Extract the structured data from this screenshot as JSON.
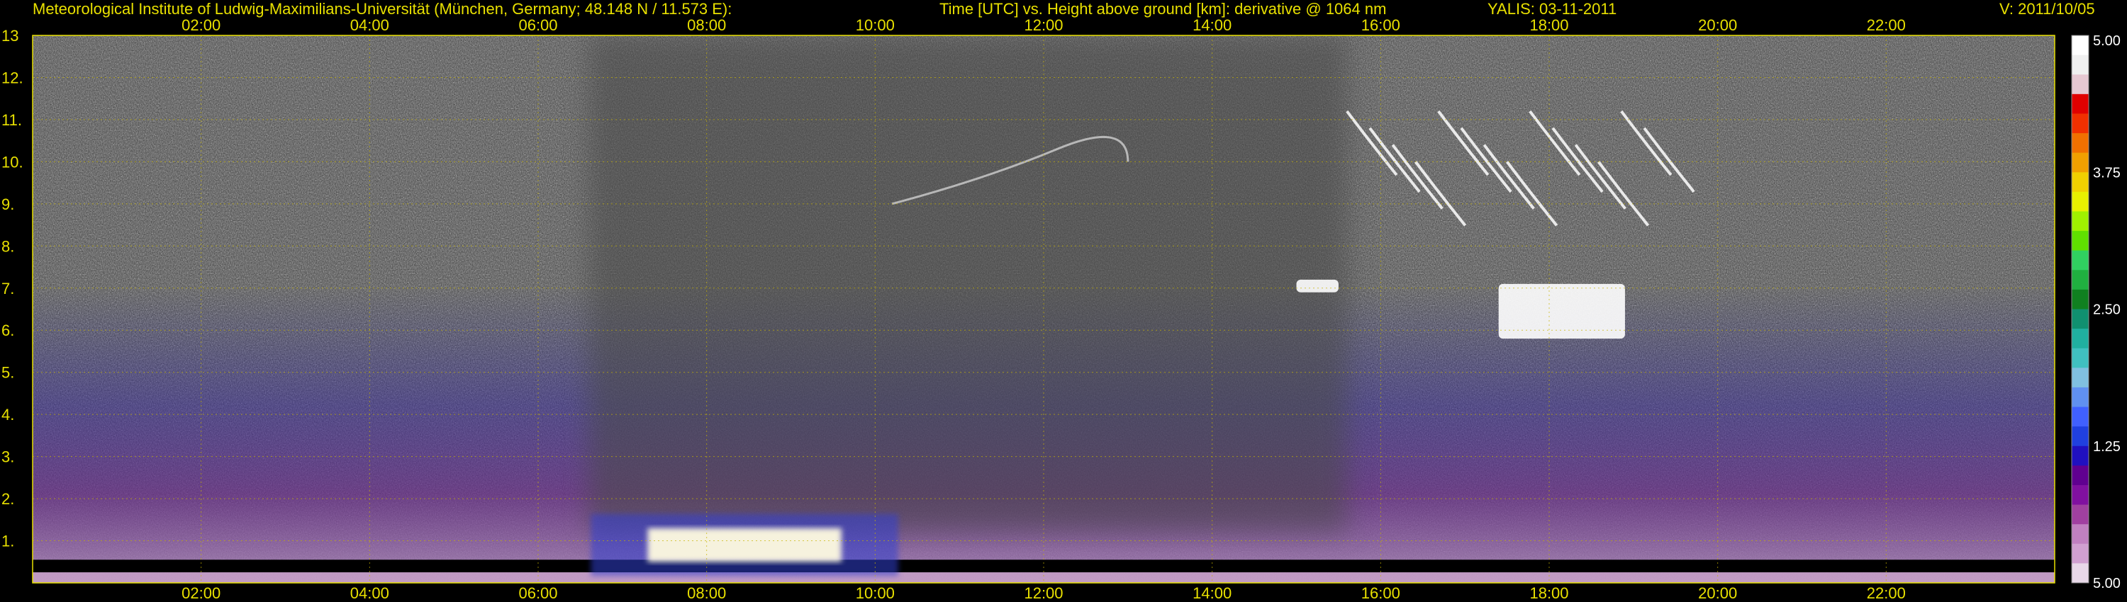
{
  "header": {
    "institute": "Meteorological Institute of Ludwig-Maximilians-Universität (München, Germany; 48.148 N / 11.573 E):",
    "axes_desc": "Time [UTC] vs. Height above ground [km]: derivative @ 1064 nm",
    "instrument_date": "YALIS: 03-11-2011",
    "version": "V: 2011/10/05"
  },
  "colors": {
    "axis_text": "#e8e000",
    "grid": "#c8b400",
    "background": "#000000"
  },
  "chart_data": {
    "type": "heatmap",
    "xlabel": "Time [UTC]",
    "ylabel": "Height above ground [km]",
    "xlim": [
      0,
      24
    ],
    "ylim": [
      0,
      13
    ],
    "grid": true,
    "x_tick_values": [
      2,
      4,
      6,
      8,
      10,
      12,
      14,
      16,
      18,
      20,
      22
    ],
    "x_tick_labels": [
      "02:00",
      "04:00",
      "06:00",
      "08:00",
      "10:00",
      "12:00",
      "14:00",
      "16:00",
      "18:00",
      "20:00",
      "22:00"
    ],
    "y_tick_values": [
      1,
      2,
      3,
      4,
      5,
      6,
      7,
      8,
      9,
      10,
      11,
      12,
      13
    ],
    "y_tick_labels": [
      "1.",
      "2.",
      "3.",
      "4.",
      "5.",
      "6.",
      "7.",
      "8.",
      "9.",
      "10.",
      "11.",
      "12.",
      "13"
    ],
    "colorbar": {
      "tick_values": [
        5.0,
        3.75,
        2.5,
        1.25,
        5.0
      ],
      "tick_labels": [
        "5.00",
        "3.75",
        "2.50",
        "1.25",
        "5.00"
      ],
      "colors": [
        "#ffffff",
        "#f0f0f0",
        "#e6c8d2",
        "#e00000",
        "#f03000",
        "#f07000",
        "#f0a000",
        "#f0d000",
        "#e8f000",
        "#a0f000",
        "#60e000",
        "#30d060",
        "#20b040",
        "#108020",
        "#109070",
        "#20b0a0",
        "#40c0c0",
        "#80c0e0",
        "#6090f0",
        "#4060ff",
        "#2040e0",
        "#2010c0",
        "#600090",
        "#8010a0",
        "#a040a0",
        "#c080c0",
        "#d0a0d0",
        "#e8d8e8"
      ]
    },
    "features": [
      {
        "name": "surface-bright-layer",
        "t_start": 7.3,
        "t_end": 9.6,
        "h_bottom": 0.5,
        "h_top": 1.3
      },
      {
        "name": "cirrus-upper",
        "t_start": 15.6,
        "t_end": 19.4,
        "h_bottom": 8.2,
        "h_top": 11.2
      },
      {
        "name": "thin-layer-upper-left",
        "t_start": 10.2,
        "t_end": 13.0,
        "h_bottom": 8.8,
        "h_top": 10.3
      },
      {
        "name": "cloud-fragments-mid",
        "t_start": 15.0,
        "t_end": 15.5,
        "h_bottom": 6.9,
        "h_top": 7.2
      },
      {
        "name": "cloud-fragments-low",
        "t_start": 17.4,
        "t_end": 18.9,
        "h_bottom": 5.8,
        "h_top": 7.1
      },
      {
        "name": "boundary-layer-haze",
        "t_start": 0.0,
        "t_end": 24.0,
        "h_bottom": 0.0,
        "h_top": 4.0
      }
    ]
  }
}
